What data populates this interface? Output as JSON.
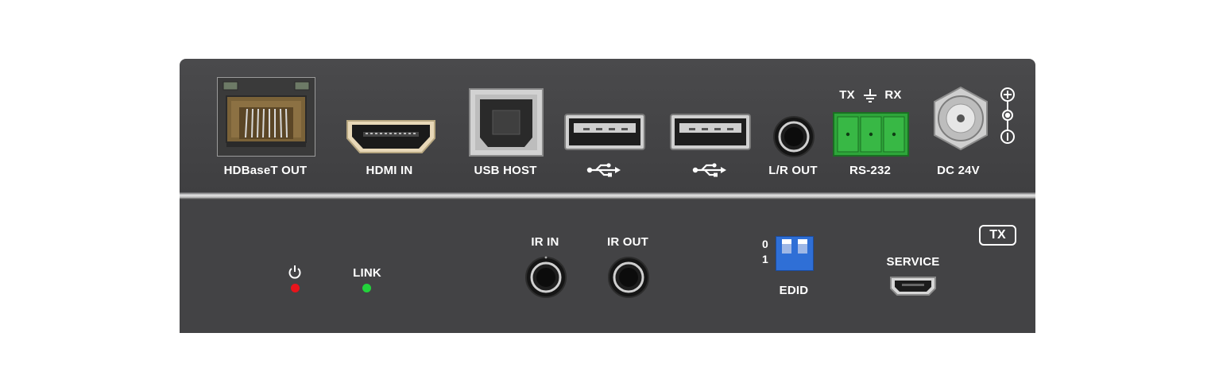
{
  "rear_panel": {
    "ports": [
      {
        "label": "HDBaseT OUT"
      },
      {
        "label": "HDMI IN"
      },
      {
        "label": "USB HOST"
      },
      {
        "label": "L/R OUT"
      },
      {
        "label": "RS-232"
      },
      {
        "label": "DC 24V"
      }
    ],
    "rs232_pins": {
      "tx": "TX",
      "rx": "RX"
    }
  },
  "front_panel": {
    "badge": "TX",
    "link_label": "LINK",
    "ir_in_label": "IR IN",
    "ir_out_label": "IR OUT",
    "edid_label": "EDID",
    "edid_switch_positions": {
      "off": "0",
      "on": "1"
    },
    "service_label": "SERVICE",
    "power_led_color": "#e8141b",
    "link_led_color": "#22d33b"
  },
  "colors": {
    "panel": "#434345",
    "terminal_green": "#2ea63a",
    "dip_blue": "#2f6fd6"
  }
}
